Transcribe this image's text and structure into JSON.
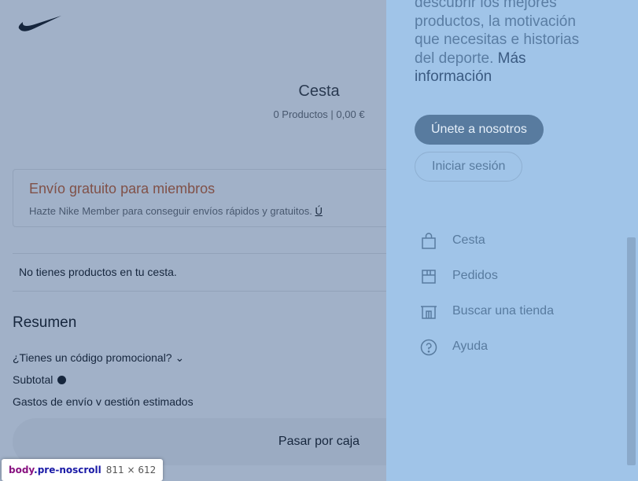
{
  "background": {
    "logo_icon": "swoosh-logo-icon",
    "cart_title": "Cesta",
    "cart_subtitle": "0 Productos | 0,00 €",
    "member_title": "Envío gratuito para miembros",
    "member_text": "Hazte Nike Member para conseguir envíos rápidos y gratuitos. ",
    "member_link": "Ú",
    "no_products": "No tienes productos en tu cesta.",
    "summary_title": "Resumen",
    "promo_code": "¿Tienes un código promocional? ⌄",
    "subtotal": "Subtotal",
    "shipping": "Gastos de envío y gestión estimados",
    "checkout_button": "Pasar por caja"
  },
  "menu": {
    "promo_line1": "descubrir los mejores",
    "promo_line2": "productos, la motivación",
    "promo_line3": "que necesitas e historias",
    "promo_line4": "del deporte. ",
    "promo_more1": "Más",
    "promo_more2": "información",
    "join_button": "Únete a nosotros",
    "login_button": "Iniciar sesión",
    "items": [
      {
        "label": "Cesta",
        "icon": "bag-icon"
      },
      {
        "label": "Pedidos",
        "icon": "box-icon"
      },
      {
        "label": "Buscar una tienda",
        "icon": "store-icon"
      },
      {
        "label": "Ayuda",
        "icon": "help-icon"
      }
    ]
  },
  "devtools": {
    "tag": "body",
    "class": ".pre-noscroll",
    "dimensions": "811 × 612"
  },
  "colors": {
    "menu_bg": "#a0c4e8",
    "join_button_bg": "#587b9f",
    "menu_text": "#587b9f",
    "overlay": "rgba(30,70,125,0.42)"
  }
}
